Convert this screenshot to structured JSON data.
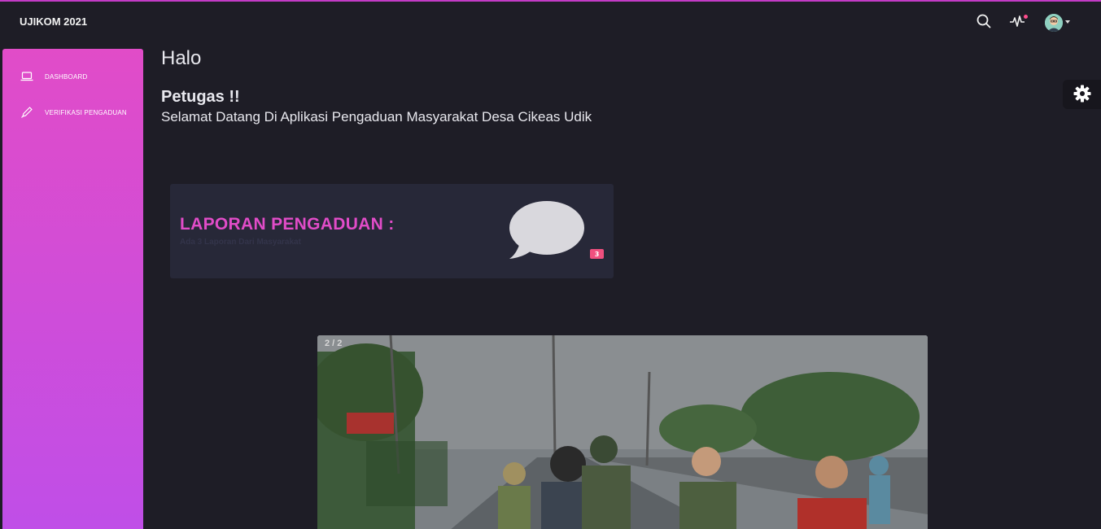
{
  "app": {
    "title": "UJIKOM 2021"
  },
  "topbar": {
    "icons": [
      "search-icon",
      "activity-icon",
      "avatar",
      "chevron-down-icon"
    ],
    "notification_color": "#ff4d8d"
  },
  "sidebar": {
    "items": [
      {
        "label": "DASHBOARD",
        "icon": "laptop-icon"
      },
      {
        "label": "VERIFIKASI PENGADUAN",
        "icon": "pencil-icon"
      }
    ],
    "gradient": [
      "#e14cc8",
      "#bf4ee8"
    ]
  },
  "main": {
    "greeting": "Halo",
    "role": "Petugas !!",
    "welcome": "Selamat Datang Di Aplikasi Pengaduan Masyarakat Desa Cikeas Udik"
  },
  "report_card": {
    "title": "LAPORAN PENGADUAN :",
    "subtitle": "Ada 3 Laporan Dari Masyarakat",
    "count": "3",
    "icon": "speech-bubble-icon",
    "accent": "#e14cc8"
  },
  "carousel": {
    "counter": "2 / 2"
  },
  "settings": {
    "icon": "gear-icon"
  }
}
